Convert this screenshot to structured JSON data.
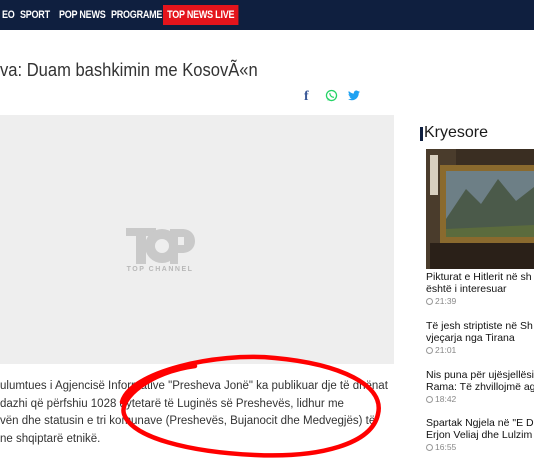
{
  "nav": {
    "items": [
      "EO",
      "SPORT",
      "POP NEWS",
      "PROGRAME"
    ],
    "live_label": "TOP NEWS LIVE"
  },
  "article": {
    "title": "va: Duam bashkimin me KosovÃ«n",
    "body_lines": [
      "ulumtues i Agjencisë Informative \"Presheva Jonë\" ka publikuar dje të dhënat",
      "dazhi që përfshiu 1028 qytetarë të Luginës së Preshevës, lidhur me",
      "vën dhe statusin e tri komunave (Preshevës, Bujanocit dhe Medvegjës) të",
      "ne shqiptarë etnikë."
    ]
  },
  "video": {
    "logo_text": "TOP CHANNEL"
  },
  "share": {
    "facebook": "f",
    "whatsapp": "✆",
    "twitter": "▶"
  },
  "sidebar": {
    "title": "Kryesore",
    "items": [
      {
        "headline_1": "Pikturat e Hitlerit në sh",
        "headline_2": "është i interesuar",
        "time": "21:39"
      },
      {
        "headline_1": "Të jesh striptiste në Sh",
        "headline_2": "vjeçarja nga Tirana",
        "time": "21:01"
      },
      {
        "headline_1": "Nis puna për ujësjellësi",
        "headline_2": "Rama: Të zhvillojmë ag",
        "time": "18:42"
      },
      {
        "headline_1": "Spartak Ngjela në \"E Di",
        "headline_2": "Erjon Veliaj dhe Lulzim",
        "time": "16:55"
      }
    ]
  },
  "colors": {
    "nav_bg": "#0f1f3f",
    "live_red": "#e4141c",
    "annotation_red": "#ff0000"
  }
}
